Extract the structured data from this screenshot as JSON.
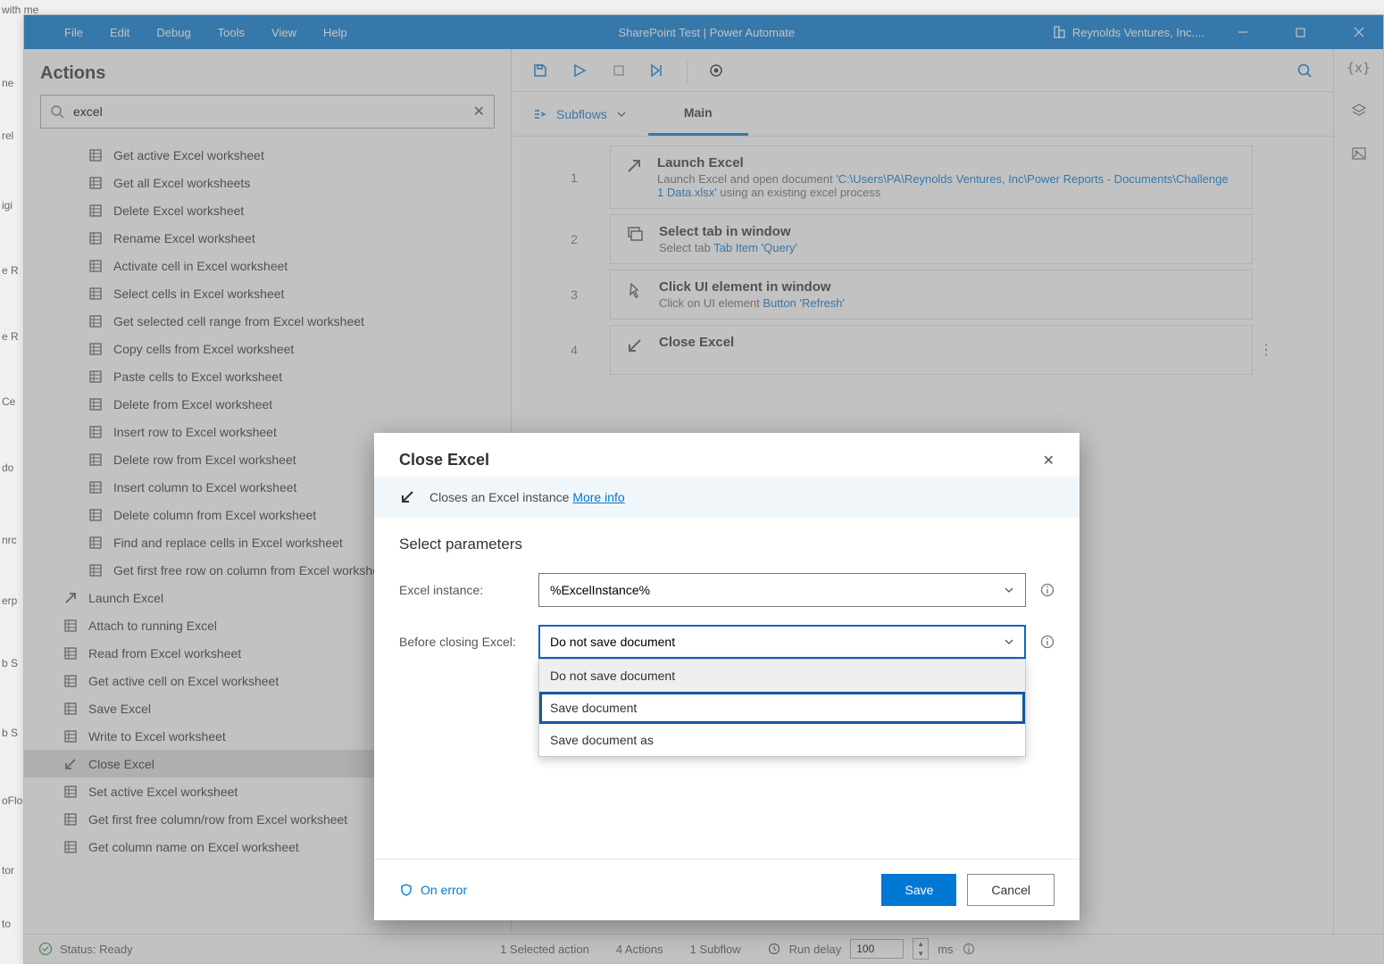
{
  "stray": {
    "top": "with me",
    "side": [
      "ne",
      "rel",
      "igi",
      "e R",
      "e R",
      "Ce",
      "do",
      "nrc",
      "erp",
      "b S",
      "b S",
      "oFlo",
      "tor",
      "to"
    ]
  },
  "titlebar": {
    "menus": [
      "File",
      "Edit",
      "Debug",
      "Tools",
      "View",
      "Help"
    ],
    "title": "SharePoint Test | Power Automate",
    "org": "Reynolds Ventures, Inc...."
  },
  "actions": {
    "title": "Actions",
    "search": "excel",
    "items": [
      {
        "label": "Get active Excel worksheet",
        "icon": "xl",
        "indent": 1
      },
      {
        "label": "Get all Excel worksheets",
        "icon": "xl",
        "indent": 1
      },
      {
        "label": "Delete Excel worksheet",
        "icon": "xl",
        "indent": 1
      },
      {
        "label": "Rename Excel worksheet",
        "icon": "xl",
        "indent": 1
      },
      {
        "label": "Activate cell in Excel worksheet",
        "icon": "xl",
        "indent": 1
      },
      {
        "label": "Select cells in Excel worksheet",
        "icon": "xl",
        "indent": 1
      },
      {
        "label": "Get selected cell range from Excel worksheet",
        "icon": "xl",
        "indent": 1
      },
      {
        "label": "Copy cells from Excel worksheet",
        "icon": "xl",
        "indent": 1
      },
      {
        "label": "Paste cells to Excel worksheet",
        "icon": "xl",
        "indent": 1
      },
      {
        "label": "Delete from Excel worksheet",
        "icon": "xl",
        "indent": 1
      },
      {
        "label": "Insert row to Excel worksheet",
        "icon": "xl",
        "indent": 1
      },
      {
        "label": "Delete row from Excel worksheet",
        "icon": "xl",
        "indent": 1
      },
      {
        "label": "Insert column to Excel worksheet",
        "icon": "xl",
        "indent": 1
      },
      {
        "label": "Delete column from Excel worksheet",
        "icon": "xl",
        "indent": 1
      },
      {
        "label": "Find and replace cells in Excel worksheet",
        "icon": "xl",
        "indent": 1
      },
      {
        "label": "Get first free row on column from Excel worksheet",
        "icon": "xl",
        "indent": 1
      },
      {
        "label": "Launch Excel",
        "icon": "arrow",
        "indent": 0
      },
      {
        "label": "Attach to running Excel",
        "icon": "xl",
        "indent": 0
      },
      {
        "label": "Read from Excel worksheet",
        "icon": "xl",
        "indent": 0
      },
      {
        "label": "Get active cell on Excel worksheet",
        "icon": "xl",
        "indent": 0
      },
      {
        "label": "Save Excel",
        "icon": "xl",
        "indent": 0
      },
      {
        "label": "Write to Excel worksheet",
        "icon": "xl",
        "indent": 0
      },
      {
        "label": "Close Excel",
        "icon": "arrowdl",
        "indent": 0,
        "selected": true
      },
      {
        "label": "Set active Excel worksheet",
        "icon": "xl",
        "indent": 0
      },
      {
        "label": "Get first free column/row from Excel worksheet",
        "icon": "xl",
        "indent": 0
      },
      {
        "label": "Get column name on Excel worksheet",
        "icon": "xl",
        "indent": 0
      }
    ]
  },
  "subflow": {
    "label": "Subflows",
    "tab": "Main"
  },
  "steps": [
    {
      "num": "1",
      "icon": "arrow",
      "title": "Launch Excel",
      "desc_pre": "Launch Excel and open document ",
      "desc_link": "'C:\\Users\\PA\\Reynolds Ventures, Inc\\Power Reports - Documents\\Challenge 1 Data.xlsx'",
      "desc_post": " using an existing excel process"
    },
    {
      "num": "2",
      "icon": "window",
      "title": "Select tab in window",
      "desc_pre": "Select tab ",
      "desc_link": "Tab Item 'Query'",
      "desc_post": ""
    },
    {
      "num": "3",
      "icon": "click",
      "title": "Click UI element in window",
      "desc_pre": "Click on UI element ",
      "desc_link": "Button 'Refresh'",
      "desc_post": ""
    },
    {
      "num": "4",
      "icon": "arrowdl",
      "title": "Close Excel",
      "desc_pre": "",
      "desc_link": "",
      "desc_post": "",
      "more": true
    }
  ],
  "modal": {
    "title": "Close Excel",
    "info": "Closes an Excel instance",
    "more": "More info",
    "section": "Select parameters",
    "params": {
      "instance_label": "Excel instance:",
      "instance_value": "%ExcelInstance%",
      "before_label": "Before closing Excel:",
      "before_value": "Do not save document",
      "options": [
        "Do not save document",
        "Save document",
        "Save document as"
      ]
    },
    "on_error": "On error",
    "save": "Save",
    "cancel": "Cancel"
  },
  "status": {
    "ready": "Status: Ready",
    "selected": "1 Selected action",
    "actions": "4 Actions",
    "subflow": "1 Subflow",
    "run_delay": "Run delay",
    "delay_val": "100",
    "ms": "ms"
  }
}
